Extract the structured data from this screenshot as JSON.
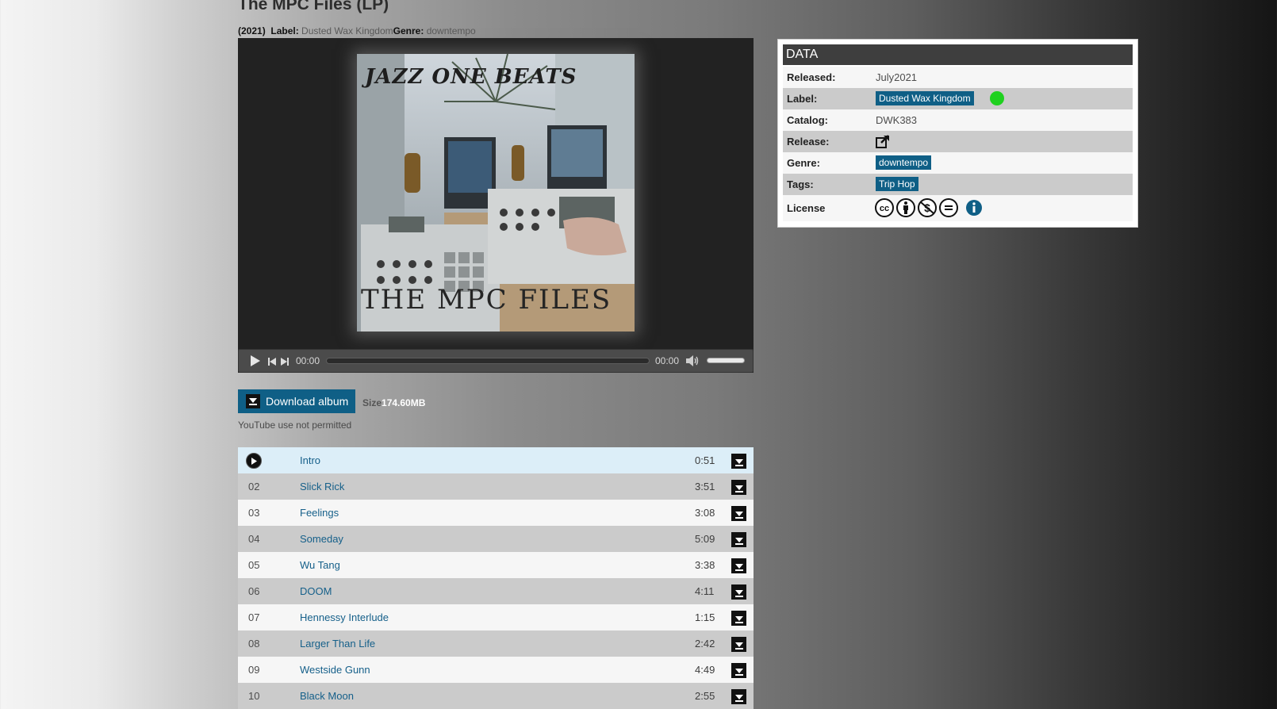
{
  "album": {
    "title": "The MPC Files (LP)",
    "year": "(2021)",
    "label_key": "Label:",
    "label_value": "Dusted Wax Kingdom",
    "genre_key": "Genre:",
    "genre_value": "downtempo"
  },
  "cover": {
    "top_text": "JAZZ ONE BEATS",
    "bottom_text": "THE MPC FILES"
  },
  "player": {
    "current_time": "00:00",
    "total_time": "00:00"
  },
  "download": {
    "button_label": "Download album",
    "size_key": "Size",
    "size_value": "174.60MB",
    "youtube_note": "YouTube use not permitted"
  },
  "tracks": [
    {
      "num": "",
      "name": "Intro",
      "duration": "0:51"
    },
    {
      "num": "02",
      "name": "Slick Rick",
      "duration": "3:51"
    },
    {
      "num": "03",
      "name": "Feelings",
      "duration": "3:08"
    },
    {
      "num": "04",
      "name": "Someday",
      "duration": "5:09"
    },
    {
      "num": "05",
      "name": "Wu Tang",
      "duration": "3:38"
    },
    {
      "num": "06",
      "name": "DOOM",
      "duration": "4:11"
    },
    {
      "num": "07",
      "name": "Hennessy Interlude",
      "duration": "1:15"
    },
    {
      "num": "08",
      "name": "Larger Than Life",
      "duration": "2:42"
    },
    {
      "num": "09",
      "name": "Westside Gunn",
      "duration": "4:49"
    },
    {
      "num": "10",
      "name": "Black Moon",
      "duration": "2:55"
    }
  ],
  "data_panel": {
    "heading": "DATA",
    "released_key": "Released:",
    "released_value": "July2021",
    "label_key": "Label:",
    "label_value": "Dusted Wax Kingdom",
    "catalog_key": "Catalog:",
    "catalog_value": "DWK383",
    "release_key": "Release:",
    "genre_key": "Genre:",
    "genre_value": "downtempo",
    "tags_key": "Tags:",
    "tags_value": "Trip Hop",
    "license_key": "License"
  },
  "colors": {
    "accent": "#0f5f86",
    "label_status": "#1fd11f",
    "link": "#16608a",
    "info": "#0f5f86"
  }
}
